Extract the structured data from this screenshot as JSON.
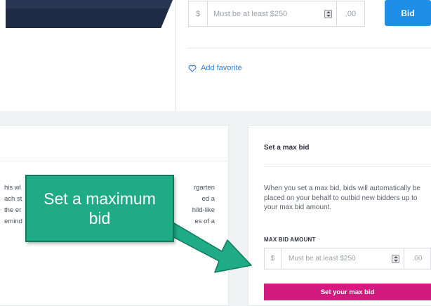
{
  "bid_form": {
    "currency": "$",
    "amount_placeholder": "Must be at least $250",
    "cents": ".00",
    "bid_label": "Bid"
  },
  "favorite": {
    "label": "Add favorite",
    "icon": "heart-icon"
  },
  "description_fragments": [
    {
      "left": "his wl",
      "right": "rgarten"
    },
    {
      "left": "ach st",
      "right": "ed a"
    },
    {
      "left": "the er",
      "right": "hild-like"
    },
    {
      "left": "emind",
      "right": "es of a"
    }
  ],
  "max_bid": {
    "title": "Set a max bid",
    "description": "When you set a max bid, bids will automatically be placed on your behalf to outbid new bidders up to your max bid amount.",
    "amount_label": "MAX BID AMOUNT",
    "currency": "$",
    "amount_placeholder": "Must be at least $250",
    "cents": ".00",
    "submit_label": "Set your max bid"
  },
  "callout": {
    "text": "Set a maximum bid"
  },
  "colors": {
    "bid_button": "#1f8ee6",
    "max_bid_button": "#d31a7f",
    "callout": "#1eab85",
    "link": "#3b7fd4"
  }
}
